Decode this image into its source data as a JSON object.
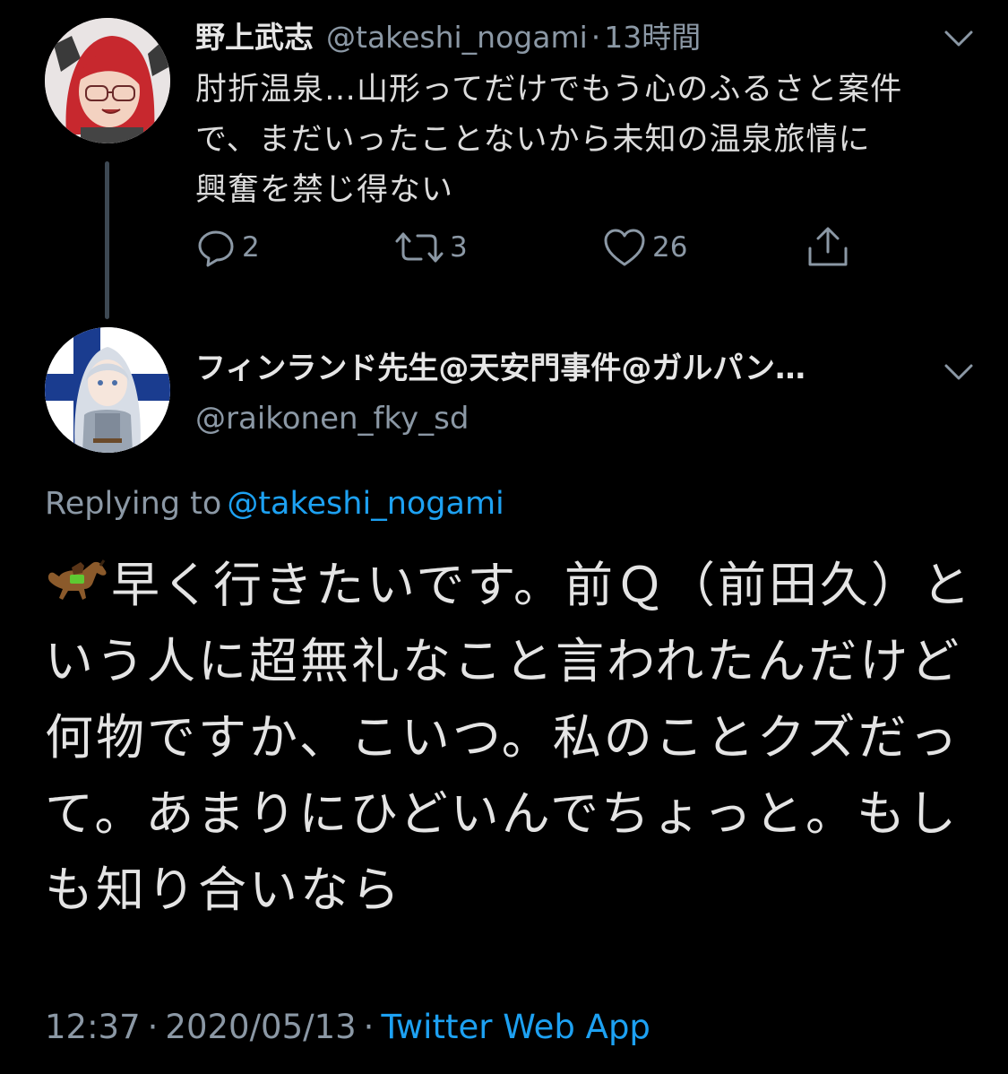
{
  "parent_tweet": {
    "author_name": "野上武志",
    "author_handle": "@takeshi_nogami",
    "separator": "·",
    "time_ago": "13時間",
    "text": "肘折温泉…山形ってだけでもう心のふるさと案件\nで、まだいったことないから未知の温泉旅情に\n興奮を禁じ得ない",
    "reply_count": "2",
    "retweet_count": "3",
    "like_count": "26"
  },
  "reply_tweet": {
    "author_name": "フィンランド先生@天安門事件@ガルパン…",
    "author_handle": "@raikonen_fky_sd",
    "replying_prefix": "Replying to",
    "replying_to": "@takeshi_nogami",
    "emoji_icon": "racehorse-icon",
    "text": "早く行きたいです。前Ｑ（前田久）という人に超無礼なこと言われたんだけど何物ですか、こいつ。私のことクズだって。あまりにひどいんでちょっと。もしも知り合いなら",
    "time": "12:37",
    "date": "2020/05/13",
    "separator": "·",
    "source_app": "Twitter Web App"
  },
  "colors": {
    "background": "#000000",
    "secondary_text": "#8b98a5",
    "accent": "#1da1f2",
    "thread_line": "#3d4853"
  }
}
